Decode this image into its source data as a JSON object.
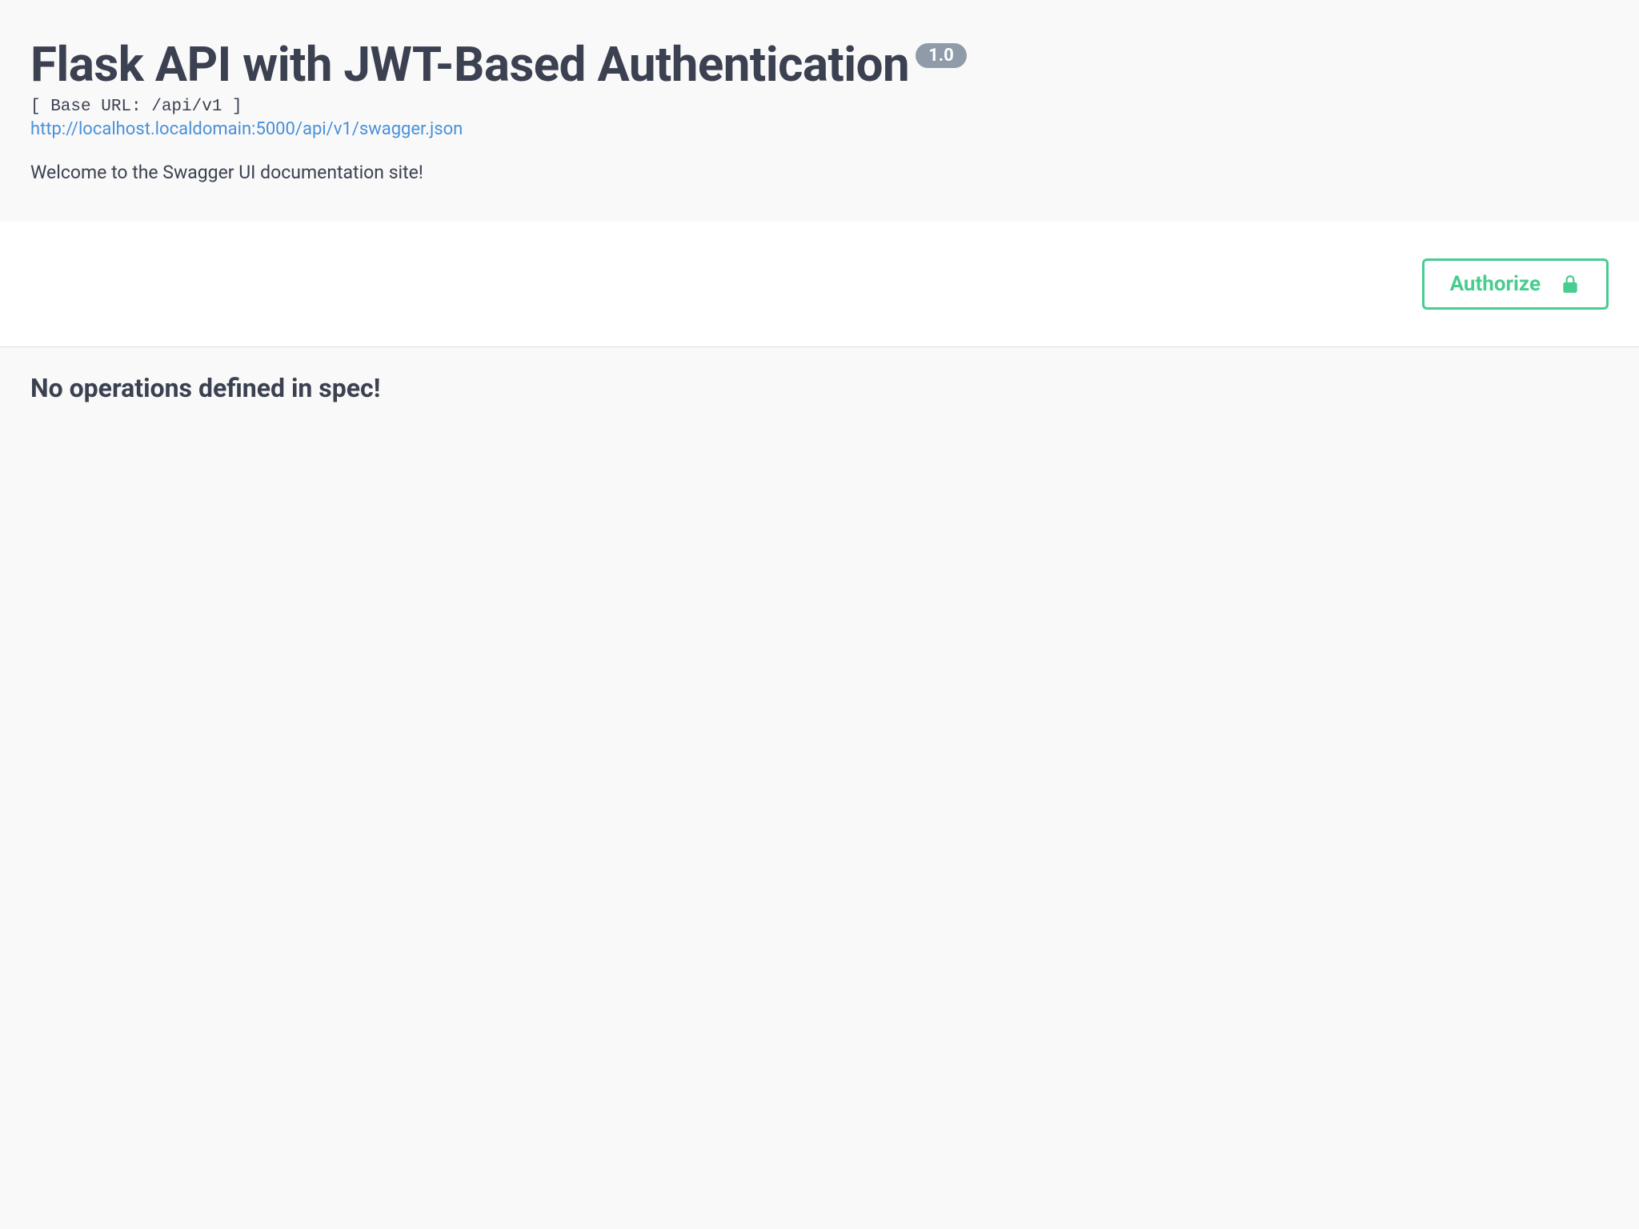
{
  "header": {
    "title": "Flask API with JWT-Based Authentication",
    "version": "1.0",
    "baseUrlLabel": "[ Base URL: /api/v1 ]",
    "swaggerJsonUrl": "http://localhost.localdomain:5000/api/v1/swagger.json",
    "description": "Welcome to the Swagger UI documentation site!"
  },
  "auth": {
    "authorizeLabel": "Authorize"
  },
  "content": {
    "noOperations": "No operations defined in spec!"
  }
}
